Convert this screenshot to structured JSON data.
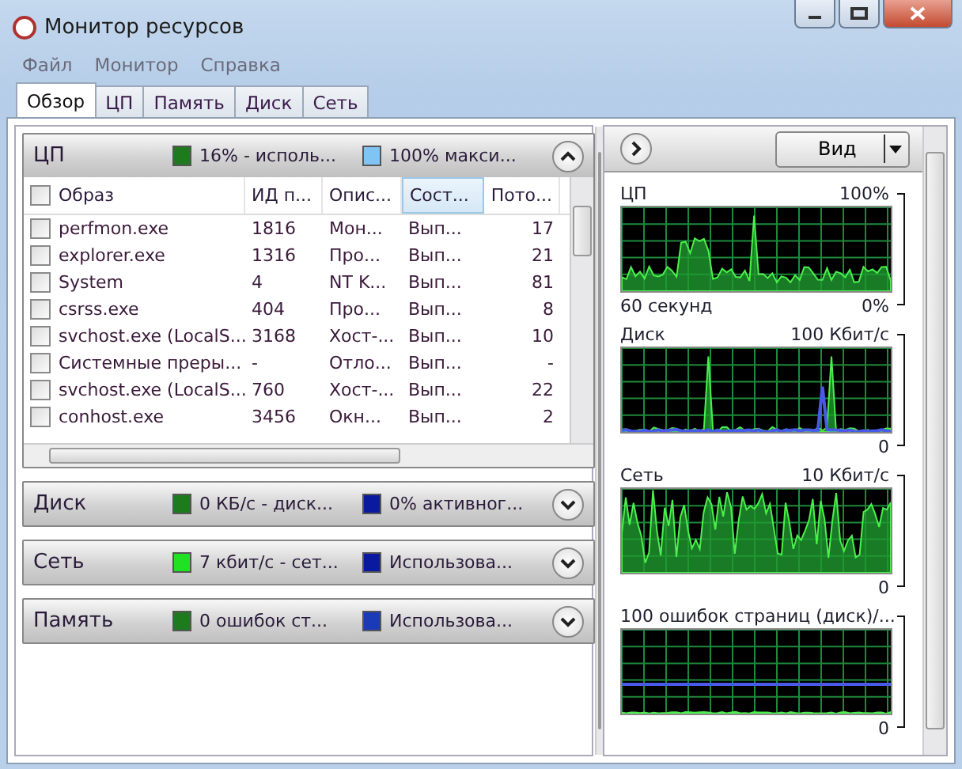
{
  "window": {
    "title": "Монитор ресурсов"
  },
  "menu": [
    "Файл",
    "Монитор",
    "Справка"
  ],
  "tabs": [
    {
      "label": "Обзор",
      "selected": true
    },
    {
      "label": "ЦП",
      "selected": false
    },
    {
      "label": "Память",
      "selected": false
    },
    {
      "label": "Диск",
      "selected": false
    },
    {
      "label": "Сеть",
      "selected": false
    }
  ],
  "sections": [
    {
      "title": "ЦП",
      "expanded": true,
      "legend": [
        {
          "text": "16% - исполь...",
          "color": "#1f7a1f"
        },
        {
          "text": "100% макси...",
          "color": "#80c4f4"
        }
      ],
      "table": {
        "columns": [
          {
            "label": "Образ",
            "sorted": false
          },
          {
            "label": "ИД п...",
            "sorted": false
          },
          {
            "label": "Опис...",
            "sorted": false
          },
          {
            "label": "Сост...",
            "sorted": true
          },
          {
            "label": "Пото...",
            "sorted": false
          }
        ],
        "rows": [
          {
            "checked": false,
            "cells": [
              "perfmon.exe",
              "1816",
              "Мон...",
              "Вып...",
              "17"
            ]
          },
          {
            "checked": false,
            "cells": [
              "explorer.exe",
              "1316",
              "Про...",
              "Вып...",
              "21"
            ]
          },
          {
            "checked": false,
            "cells": [
              "System",
              "4",
              "NT K...",
              "Вып...",
              "81"
            ]
          },
          {
            "checked": false,
            "cells": [
              "csrss.exe",
              "404",
              "Про...",
              "Вып...",
              "8"
            ]
          },
          {
            "checked": false,
            "cells": [
              "svchost.exe (LocalS...",
              "3168",
              "Хост-...",
              "Вып...",
              "10"
            ]
          },
          {
            "checked": false,
            "cells": [
              "Системные преры...",
              "-",
              "Отло...",
              "Вып...",
              "-"
            ]
          },
          {
            "checked": false,
            "cells": [
              "svchost.exe (LocalS...",
              "760",
              "Хост-...",
              "Вып...",
              "22"
            ]
          },
          {
            "checked": false,
            "cells": [
              "conhost.exe",
              "3456",
              "Окн...",
              "Вып...",
              "2"
            ]
          }
        ]
      }
    },
    {
      "title": "Диск",
      "expanded": false,
      "legend": [
        {
          "text": "0 КБ/с - диск...",
          "color": "#1f7a1f"
        },
        {
          "text": "0% активног...",
          "color": "#0a1aa0"
        }
      ]
    },
    {
      "title": "Сеть",
      "expanded": false,
      "legend": [
        {
          "text": "7 кбит/с - сет...",
          "color": "#22e022"
        },
        {
          "text": "Использова...",
          "color": "#0a1aa0"
        }
      ]
    },
    {
      "title": "Память",
      "expanded": false,
      "legend": [
        {
          "text": "0 ошибок ст...",
          "color": "#1f7a1f"
        },
        {
          "text": "Использова...",
          "color": "#1a3ab8"
        }
      ]
    }
  ],
  "view_button": "Вид",
  "graphs": [
    {
      "kind": "cpu",
      "title": "ЦП",
      "max": "100%",
      "time": "60 секунд",
      "min": "0%"
    },
    {
      "kind": "disk",
      "title": "Диск",
      "max": "100 Кбит/с",
      "min": "0"
    },
    {
      "kind": "net",
      "title": "Сеть",
      "max": "10 Кбит/с",
      "min": "0"
    },
    {
      "kind": "mem",
      "title": "100 ошибок страниц (диск)/...",
      "min": "0"
    }
  ]
}
